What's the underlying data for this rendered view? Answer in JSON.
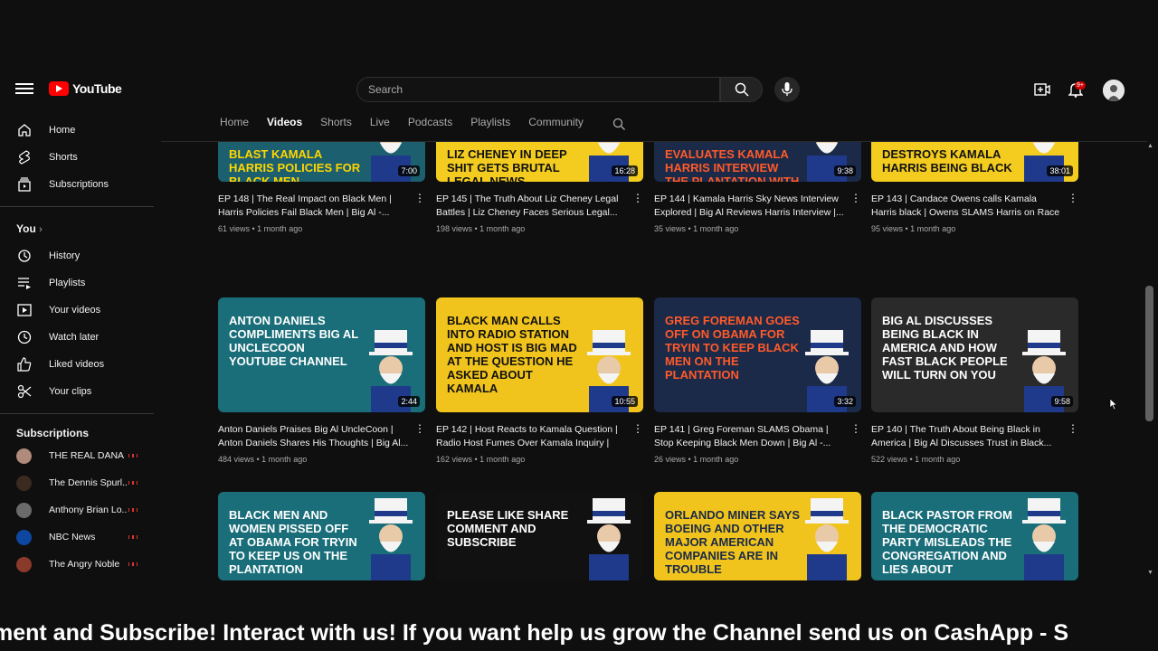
{
  "header": {
    "logo_text": "YouTube",
    "search_placeholder": "Search",
    "notification_count": "9+"
  },
  "sidebar": {
    "main": [
      {
        "label": "Home",
        "icon": "home-icon"
      },
      {
        "label": "Shorts",
        "icon": "shorts-icon"
      },
      {
        "label": "Subscriptions",
        "icon": "subscriptions-icon"
      }
    ],
    "you_heading": "You",
    "you_items": [
      {
        "label": "History",
        "icon": "history-icon"
      },
      {
        "label": "Playlists",
        "icon": "playlists-icon"
      },
      {
        "label": "Your videos",
        "icon": "your-videos-icon"
      },
      {
        "label": "Watch later",
        "icon": "watch-later-icon"
      },
      {
        "label": "Liked videos",
        "icon": "liked-videos-icon"
      },
      {
        "label": "Your clips",
        "icon": "clips-icon"
      }
    ],
    "subscriptions_heading": "Subscriptions",
    "subscriptions": [
      {
        "name": "THE REAL DANA",
        "color": "#b08a7a"
      },
      {
        "name": "The Dennis Spurl...",
        "color": "#3a2a20"
      },
      {
        "name": "Anthony Brian Lo...",
        "color": "#6a6a6a"
      },
      {
        "name": "NBC News",
        "color": "#0d47a1"
      },
      {
        "name": "The Angry Noble",
        "color": "#8a3a2a"
      }
    ]
  },
  "tabs": [
    "Home",
    "Videos",
    "Shorts",
    "Live",
    "Podcasts",
    "Playlists",
    "Community"
  ],
  "active_tab": "Videos",
  "videos": [
    {
      "thumb_text": "BLAST KAMALA HARRIS POLICIES  FOR BLACK MEN",
      "bg": "#1c5f6e",
      "text_color": "#ffd600",
      "duration": "7:00",
      "title": "EP 148 | The Real Impact on Black Men | Harris Policies Fail Black Men | Big Al -...",
      "meta": "61 views • 1 month ago"
    },
    {
      "thumb_text": "LIZ CHENEY IN DEEP SHIT GETS BRUTAL LEGAL NEWS",
      "bg": "#f3cc1f",
      "text_color": "#111111",
      "duration": "16:28",
      "title": "EP 145 | The Truth About Liz Cheney Legal Battles | Liz Cheney Faces Serious Legal...",
      "meta": "198 views • 1 month ago"
    },
    {
      "thumb_text": "EVALUATES KAMALA HARRIS INTERVIEW THE PLANTATION WITH BRETT BAIER ON SKY NEWS",
      "bg": "#1b2a48",
      "text_color": "#ff5a2a",
      "duration": "9:38",
      "title": "EP 144 | Kamala Harris Sky News Interview Explored | Big Al Reviews Harris Interview |...",
      "meta": "35 views • 1 month ago"
    },
    {
      "thumb_text": "DESTROYS KAMALA HARRIS BEING BLACK",
      "bg": "#f3cc1f",
      "text_color": "#111111",
      "duration": "38:01",
      "title": "EP 143 | Candace Owens calls Kamala Harris black | Owens SLAMS Harris on Race Issue...",
      "meta": "95 views • 1 month ago"
    },
    {
      "thumb_text": "ANTON DANIELS COMPLIMENTS BIG AL UNCLECOON YOUTUBE CHANNEL",
      "bg": "#1a6e7a",
      "text_color": "#ffffff",
      "duration": "2:44",
      "title": "Anton Daniels Praises Big Al UncleCoon | Anton Daniels Shares His Thoughts | Big Al...",
      "meta": "484 views • 1 month ago"
    },
    {
      "thumb_text": "BLACK MAN CALLS INTO RADIO STATION AND HOST IS BIG MAD AT THE QUESTION HE ASKED ABOUT KAMALA",
      "bg": "#f0c41c",
      "text_color": "#111111",
      "duration": "10:55",
      "title": "EP 142 | Host Reacts to Kamala Question | Radio Host Fumes Over Kamala Inquiry | Bi...",
      "meta": "162 views • 1 month ago"
    },
    {
      "thumb_text": "GREG FOREMAN GOES OFF ON OBAMA FOR TRYIN TO KEEP BLACK MEN ON THE PLANTATION",
      "bg": "#1b2a48",
      "text_color": "#ff5a2a",
      "duration": "3:32",
      "title": "EP 141 | Greg Foreman SLAMS Obama | Stop Keeping Black Men Down | Big Al -...",
      "meta": "26 views • 1 month ago"
    },
    {
      "thumb_text": "BIG AL DISCUSSES BEING BLACK IN AMERICA AND HOW FAST BLACK PEOPLE WILL TURN ON YOU",
      "bg": "#2a2a2a",
      "text_color": "#ffffff",
      "duration": "9:58",
      "title": "EP 140 | The Truth About Being Black in America | Big Al Discusses Trust in Black...",
      "meta": "522 views • 1 month ago"
    },
    {
      "thumb_text": "BLACK MEN AND WOMEN PISSED OFF AT OBAMA FOR TRYIN TO KEEP US ON THE PLANTATION",
      "bg": "#1a6e7a",
      "text_color": "#ffffff",
      "duration": "",
      "title": "",
      "meta": ""
    },
    {
      "thumb_text": "Please Like Share Comment and Subscribe",
      "bg": "#111111",
      "text_color": "#ffffff",
      "duration": "",
      "title": "",
      "meta": ""
    },
    {
      "thumb_text": "ORLANDO MINER SAYS BOEING AND OTHER MAJOR AMERICAN COMPANIES ARE IN TROUBLE",
      "bg": "#f0c41c",
      "text_color": "#1b2a48",
      "duration": "",
      "title": "",
      "meta": ""
    },
    {
      "thumb_text": "BLACK PASTOR FROM THE DEMOCRATIC PARTY MISLEADS THE CONGREGATION AND LIES ABOUT",
      "bg": "#1a6e7a",
      "text_color": "#ffffff",
      "duration": "",
      "title": "",
      "meta": ""
    }
  ],
  "ticker": "ment and Subscribe! Interact with us! If you want help us grow the Channel send us on CashApp - S"
}
